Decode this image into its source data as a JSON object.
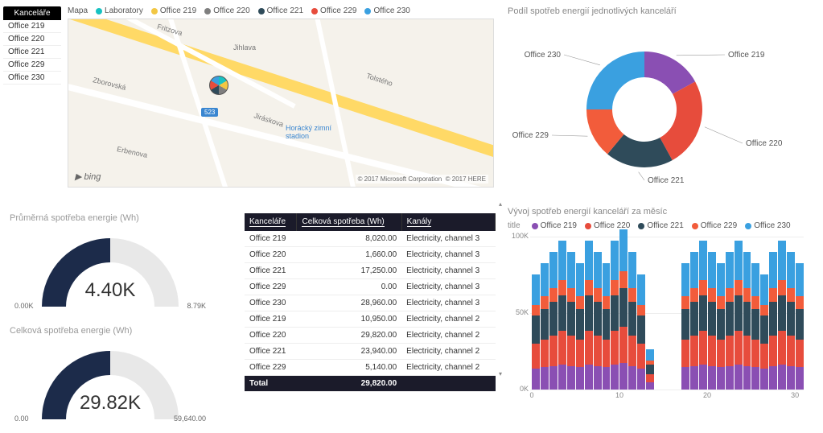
{
  "colors": {
    "office219": "#8a4fb3",
    "office220": "#e74c3c",
    "office221": "#2f4b5a",
    "office229": "#f25c3b",
    "office230": "#3aa0e0",
    "laboratory": "#17c2c2",
    "officeYellow": "#f2c744",
    "gray": "#7f7f7f",
    "gaugeFill": "#1c2b4a",
    "gaugeTrack": "#e8e8e8"
  },
  "sidebar": {
    "header": "Kanceláře",
    "items": [
      "Office 219",
      "Office 220",
      "Office 221",
      "Office 229",
      "Office 230"
    ]
  },
  "map": {
    "title": "Mapa",
    "legend": [
      {
        "label": "Laboratory",
        "color": "#17c2c2"
      },
      {
        "label": "Office 219",
        "color": "#f2c744"
      },
      {
        "label": "Office 220",
        "color": "#7f7f7f"
      },
      {
        "label": "Office 221",
        "color": "#2f4b5a"
      },
      {
        "label": "Office 229",
        "color": "#e74c3c"
      },
      {
        "label": "Office 230",
        "color": "#3aa0e0"
      }
    ],
    "roads": [
      "Fritzova",
      "Jihlava",
      "Zborovská",
      "Jiráskova",
      "Erbenova",
      "Tolstého"
    ],
    "route_badge": "523",
    "poi": "Horácký zimní stadion",
    "provider": "bing",
    "copyright_a": "© 2017 Microsoft Corporation",
    "copyright_b": "© 2017 HERE"
  },
  "donut": {
    "title": "Podíl spotřeb energií jednotlivých kanceláří"
  },
  "gauges": {
    "avg": {
      "title": "Průměrná spotřeba energie (Wh)",
      "value_label": "4.40K",
      "min": "0.00K",
      "max": "8.79K",
      "fill_frac": 0.5
    },
    "total": {
      "title": "Celková spotřeba energie (Wh)",
      "value_label": "29.82K",
      "min": "0.00",
      "max": "59,640.00",
      "fill_frac": 0.5
    }
  },
  "table": {
    "headers": [
      "Kanceláře",
      "Celková spotřeba (Wh)",
      "Kanály"
    ],
    "rows": [
      {
        "office": "Office 219",
        "val": "8,020.00",
        "ch": "Electricity, channel 3"
      },
      {
        "office": "Office 220",
        "val": "1,660.00",
        "ch": "Electricity, channel 3"
      },
      {
        "office": "Office 221",
        "val": "17,250.00",
        "ch": "Electricity, channel 3"
      },
      {
        "office": "Office 229",
        "val": "0.00",
        "ch": "Electricity, channel 3"
      },
      {
        "office": "Office 230",
        "val": "28,960.00",
        "ch": "Electricity, channel 3"
      },
      {
        "office": "Office 219",
        "val": "10,950.00",
        "ch": "Electricity, channel 2"
      },
      {
        "office": "Office 220",
        "val": "29,820.00",
        "ch": "Electricity, channel 2"
      },
      {
        "office": "Office 221",
        "val": "23,940.00",
        "ch": "Electricity, channel 2"
      },
      {
        "office": "Office 229",
        "val": "5,140.00",
        "ch": "Electricity, channel 2"
      }
    ],
    "total_label": "Total",
    "total_val": "29,820.00"
  },
  "bars": {
    "title": "Vývoj spotřeb energií kanceláří za měsíc",
    "legend_title": "title",
    "legend": [
      {
        "label": "Office 219",
        "color": "#8a4fb3"
      },
      {
        "label": "Office 220",
        "color": "#e74c3c"
      },
      {
        "label": "Office 221",
        "color": "#2f4b5a"
      },
      {
        "label": "Office 229",
        "color": "#f25c3b"
      },
      {
        "label": "Office 230",
        "color": "#3aa0e0"
      }
    ],
    "y_ticks": [
      "0K",
      "50K",
      "100K"
    ],
    "x_ticks": [
      "0",
      "10",
      "20",
      "30"
    ]
  },
  "chart_data": [
    {
      "type": "pie",
      "title": "Podíl spotřeb energií jednotlivých kanceláří",
      "series": [
        {
          "name": "Office 219",
          "value": 17,
          "color": "#8a4fb3"
        },
        {
          "name": "Office 220",
          "value": 25,
          "color": "#e74c3c"
        },
        {
          "name": "Office 221",
          "value": 19,
          "color": "#2f4b5a"
        },
        {
          "name": "Office 229",
          "value": 14,
          "color": "#f25c3b"
        },
        {
          "name": "Office 230",
          "value": 25,
          "color": "#3aa0e0"
        }
      ],
      "donut": true
    },
    {
      "type": "bar",
      "stacked": true,
      "title": "Vývoj spotřeb energií kanceláří za měsíc",
      "xlabel": "",
      "ylabel": "",
      "ylim": [
        0,
        110000
      ],
      "categories": [
        1,
        2,
        3,
        4,
        5,
        6,
        7,
        8,
        9,
        10,
        11,
        12,
        13,
        14,
        18,
        19,
        20,
        21,
        22,
        23,
        24,
        25,
        26,
        27,
        28,
        29,
        30,
        31
      ],
      "series": [
        {
          "name": "Office 219",
          "color": "#8a4fb3",
          "values": [
            15,
            16,
            17,
            18,
            17,
            16,
            18,
            17,
            16,
            18,
            19,
            17,
            15,
            5,
            16,
            17,
            18,
            17,
            16,
            17,
            18,
            17,
            16,
            15,
            17,
            18,
            17,
            16
          ]
        },
        {
          "name": "Office 220",
          "color": "#e74c3c",
          "values": [
            18,
            20,
            22,
            24,
            22,
            20,
            24,
            22,
            20,
            24,
            26,
            22,
            18,
            6,
            20,
            22,
            24,
            22,
            20,
            22,
            24,
            22,
            20,
            18,
            22,
            24,
            22,
            20
          ]
        },
        {
          "name": "Office 221",
          "color": "#2f4b5a",
          "values": [
            20,
            22,
            24,
            26,
            24,
            22,
            26,
            24,
            22,
            26,
            28,
            24,
            20,
            7,
            22,
            24,
            26,
            24,
            22,
            24,
            26,
            24,
            22,
            20,
            24,
            26,
            24,
            22
          ]
        },
        {
          "name": "Office 229",
          "color": "#f25c3b",
          "values": [
            8,
            9,
            10,
            11,
            10,
            9,
            11,
            10,
            9,
            11,
            12,
            10,
            8,
            3,
            9,
            10,
            11,
            10,
            9,
            10,
            11,
            10,
            9,
            8,
            10,
            11,
            10,
            9
          ]
        },
        {
          "name": "Office 230",
          "color": "#3aa0e0",
          "values": [
            22,
            24,
            26,
            28,
            26,
            24,
            28,
            26,
            24,
            28,
            30,
            26,
            22,
            8,
            24,
            26,
            28,
            26,
            24,
            26,
            28,
            26,
            24,
            22,
            26,
            28,
            26,
            24
          ]
        }
      ],
      "note": "values are approximate in thousands of Wh, read from chart; days 15-17 have no visible bars"
    },
    {
      "type": "table",
      "title": "Celková spotřeba",
      "columns": [
        "Kanceláře",
        "Celková spotřeba (Wh)",
        "Kanály"
      ],
      "rows": [
        [
          "Office 219",
          8020.0,
          "Electricity, channel 3"
        ],
        [
          "Office 220",
          1660.0,
          "Electricity, channel 3"
        ],
        [
          "Office 221",
          17250.0,
          "Electricity, channel 3"
        ],
        [
          "Office 229",
          0.0,
          "Electricity, channel 3"
        ],
        [
          "Office 230",
          28960.0,
          "Electricity, channel 3"
        ],
        [
          "Office 219",
          10950.0,
          "Electricity, channel 2"
        ],
        [
          "Office 220",
          29820.0,
          "Electricity, channel 2"
        ],
        [
          "Office 221",
          23940.0,
          "Electricity, channel 2"
        ],
        [
          "Office 229",
          5140.0,
          "Electricity, channel 2"
        ]
      ],
      "total": 29820.0
    }
  ]
}
